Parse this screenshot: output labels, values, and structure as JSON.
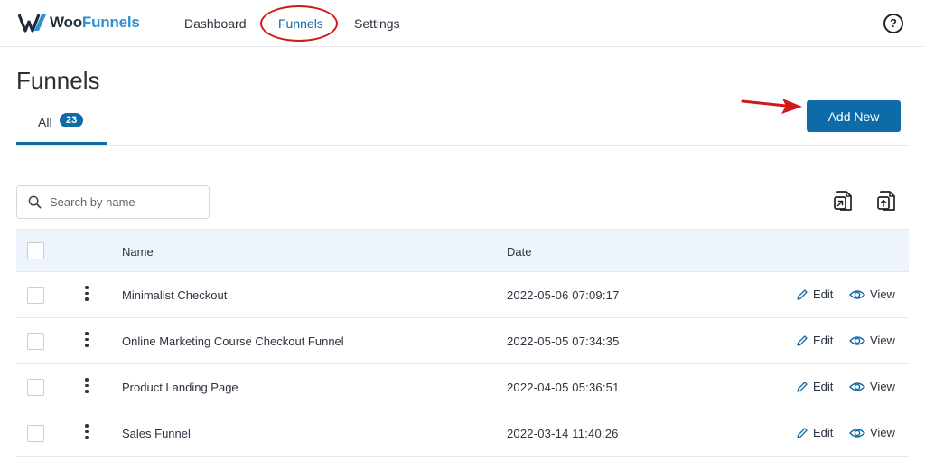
{
  "brand": {
    "name_part1": "Woo",
    "name_part2": "Funnels"
  },
  "nav": {
    "dashboard": "Dashboard",
    "funnels": "Funnels",
    "settings": "Settings",
    "help": "?"
  },
  "page": {
    "title": "Funnels",
    "add_new": "Add New"
  },
  "tabs": {
    "all_label": "All",
    "all_count": "23"
  },
  "search": {
    "placeholder": "Search by name"
  },
  "table": {
    "headers": {
      "name": "Name",
      "date": "Date"
    },
    "rows": [
      {
        "name": "Minimalist Checkout",
        "date": "2022-05-06 07:09:17",
        "edit": "Edit",
        "view": "View"
      },
      {
        "name": "Online Marketing Course Checkout Funnel",
        "date": "2022-05-05 07:34:35",
        "edit": "Edit",
        "view": "View"
      },
      {
        "name": "Product Landing Page",
        "date": "2022-04-05 05:36:51",
        "edit": "Edit",
        "view": "View"
      },
      {
        "name": "Sales Funnel",
        "date": "2022-03-14 11:40:26",
        "edit": "Edit",
        "view": "View"
      }
    ]
  },
  "colors": {
    "primary": "#0f6aa8",
    "annotation_red": "#d01a1a",
    "table_header_bg": "#edf4fb"
  },
  "icons": {
    "logo": "woofunnels-logo-icon",
    "help": "question-circle-icon",
    "search": "search-icon",
    "import": "import-icon",
    "export": "export-icon",
    "row_menu": "more-vertical-icon",
    "edit": "pencil-icon",
    "view": "eye-icon"
  }
}
